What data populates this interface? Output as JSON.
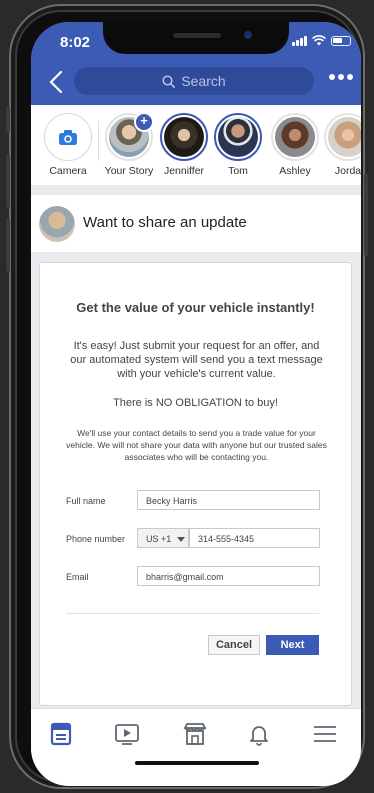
{
  "status_bar": {
    "time": "8:02"
  },
  "header": {
    "search_placeholder": "Search"
  },
  "stories": [
    {
      "label": "Camera"
    },
    {
      "label": "Your Story"
    },
    {
      "label": "Jenniffer"
    },
    {
      "label": "Tom"
    },
    {
      "label": "Ashley"
    },
    {
      "label": "Jorda"
    }
  ],
  "composer": {
    "prompt": "Want to share an update"
  },
  "form": {
    "title": "Get the value of your vehicle instantly!",
    "intro": "It's easy! Just submit your request for an offer, and our automated system will send you a text message with your vehicle's current value.",
    "obligation": "There is NO OBLIGATION to buy!",
    "disclaimer": "We'll use your contact details to send you a trade value for your vehicle. We will not share your data with anyone but our trusted sales associates who will be contacting you.",
    "full_name_label": "Full name",
    "full_name_value": "Becky Harris",
    "phone_label": "Phone number",
    "country_code": "US +1",
    "phone_value": "314-555-4345",
    "email_label": "Email",
    "email_value": "bharris@gmail.com",
    "cancel_label": "Cancel",
    "next_label": "Next"
  },
  "tabs": [
    {
      "icon": "news-feed-icon",
      "active": true
    },
    {
      "icon": "watch-video-icon",
      "active": false
    },
    {
      "icon": "marketplace-icon",
      "active": false
    },
    {
      "icon": "notifications-bell-icon",
      "active": false
    },
    {
      "icon": "menu-icon",
      "active": false
    }
  ],
  "colors": {
    "brand": "#3b5bb5",
    "search_bg": "#2f4a98",
    "feed_bg": "#e9ebee"
  }
}
